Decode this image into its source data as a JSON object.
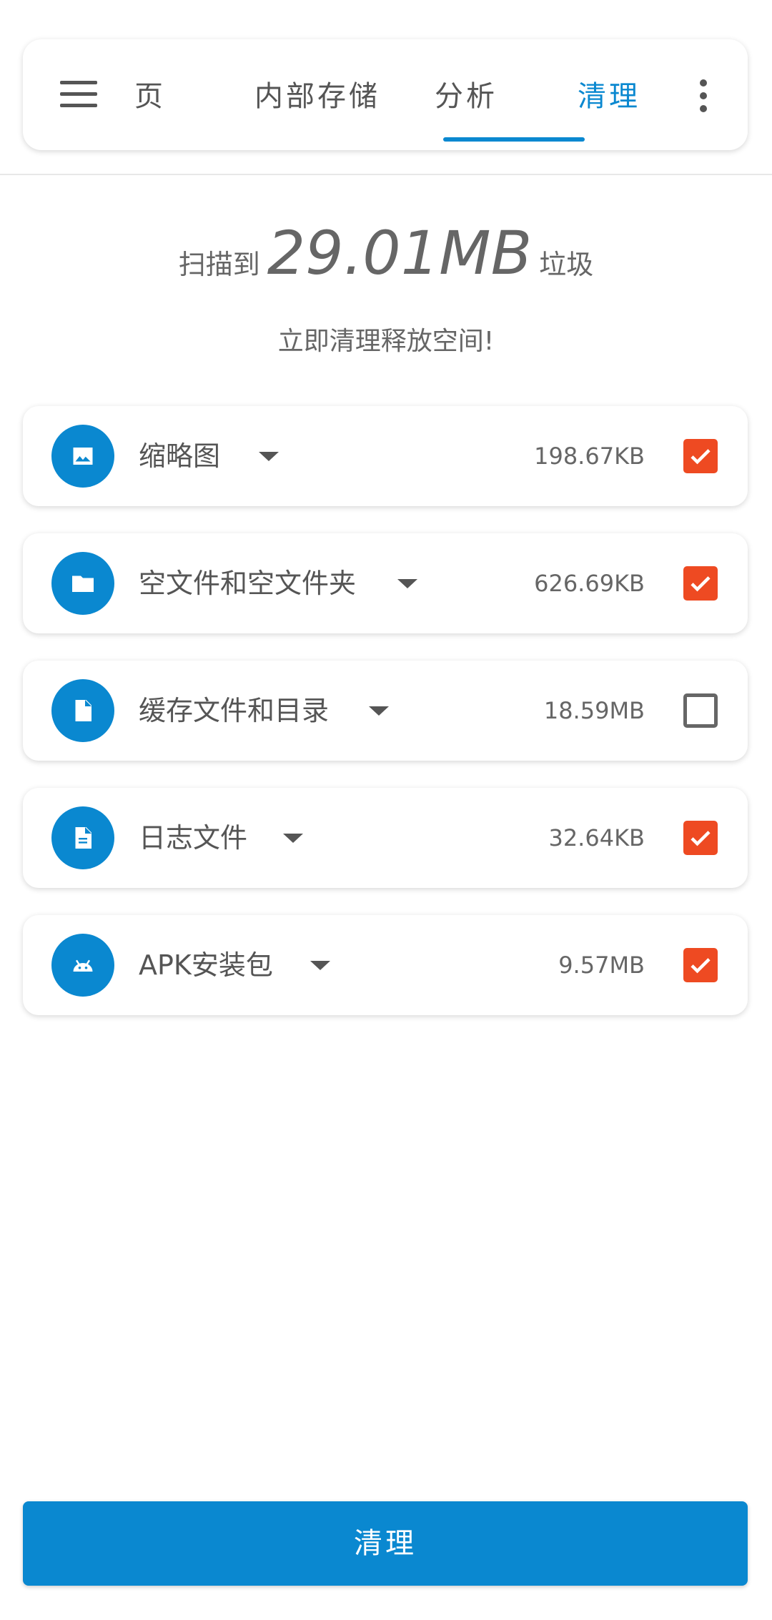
{
  "tabs": {
    "home": "主页",
    "internal_storage": "内部存储",
    "analyze": "分析",
    "clean": "清理"
  },
  "summary": {
    "prefix": "扫描到",
    "amount": "29.01MB",
    "suffix": "垃圾",
    "subtitle": "立即清理释放空间!"
  },
  "items": [
    {
      "label": "缩略图",
      "size": "198.67KB",
      "checked": true,
      "icon": "image-icon"
    },
    {
      "label": "空文件和空文件夹",
      "size": "626.69KB",
      "checked": true,
      "icon": "folder-icon"
    },
    {
      "label": "缓存文件和目录",
      "size": "18.59MB",
      "checked": false,
      "icon": "file-icon"
    },
    {
      "label": "日志文件",
      "size": "32.64KB",
      "checked": true,
      "icon": "document-icon"
    },
    {
      "label": "APK安装包",
      "size": "9.57MB",
      "checked": true,
      "icon": "android-icon"
    }
  ],
  "clean_button": "清理",
  "colors": {
    "accent": "#0a88d0",
    "checkbox": "#ee4a22",
    "text": "#555555"
  }
}
